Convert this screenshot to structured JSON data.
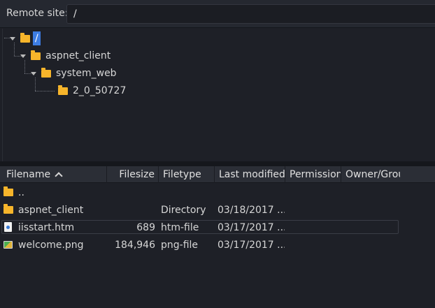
{
  "site_bar": {
    "label": "Remote site:",
    "path": "/"
  },
  "tree": {
    "root": "/",
    "nodes": [
      {
        "label": "aspnet_client",
        "expanded": true
      },
      {
        "label": "system_web",
        "expanded": true
      },
      {
        "label": "2_0_50727",
        "expanded": false
      }
    ]
  },
  "columns": {
    "filename": "Filename",
    "filesize": "Filesize",
    "filetype": "Filetype",
    "last_modified": "Last modified",
    "permissions": "Permission",
    "owner": "Owner/Grou",
    "sorted_by": "filename",
    "sort_direction": "ascending"
  },
  "files": [
    {
      "name": "..",
      "size": "",
      "type": "",
      "modified": "",
      "icon": "folder-icon"
    },
    {
      "name": "aspnet_client",
      "size": "",
      "type": "Directory",
      "modified": "03/18/2017 ...",
      "icon": "folder-icon"
    },
    {
      "name": "iisstart.htm",
      "size": "689",
      "type": "htm-file",
      "modified": "03/17/2017 ...",
      "icon": "html-file-icon"
    },
    {
      "name": "welcome.png",
      "size": "184,946",
      "type": "png-file",
      "modified": "03/17/2017 ...",
      "icon": "image-file-icon"
    }
  ],
  "colors": {
    "selection": "#3d7de4",
    "folder": "#f7b52b",
    "background": "#1e2027"
  }
}
